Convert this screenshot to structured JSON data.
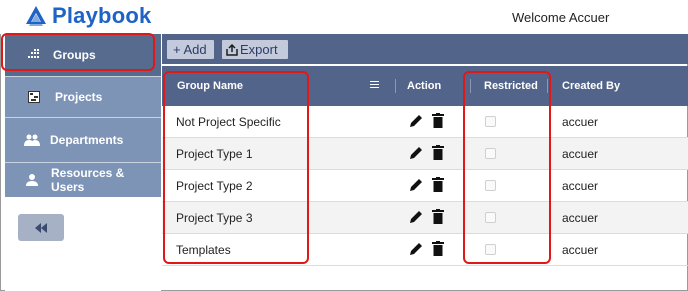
{
  "app": {
    "title": "Playbook",
    "welcome": "Welcome Accuer"
  },
  "sidebar": {
    "items": [
      {
        "label": "Groups",
        "icon": "groups-icon",
        "active": true
      },
      {
        "label": "Projects",
        "icon": "projects-icon",
        "active": false
      },
      {
        "label": "Departments",
        "icon": "departments-icon",
        "active": false
      },
      {
        "label": "Resources & Users",
        "icon": "user-icon",
        "active": false
      }
    ],
    "collapse_icon": "double-chevron-left-icon"
  },
  "toolbar": {
    "add_label": "+ Add",
    "export_label": "Export"
  },
  "table": {
    "columns": [
      "Group Name",
      "Action",
      "Restricted",
      "Created By"
    ],
    "rows": [
      {
        "name": "Not Project Specific",
        "restricted": false,
        "created_by": "accuer"
      },
      {
        "name": "Project Type 1",
        "restricted": false,
        "created_by": "accuer"
      },
      {
        "name": "Project Type 2",
        "restricted": false,
        "created_by": "accuer"
      },
      {
        "name": "Project Type 3",
        "restricted": false,
        "created_by": "accuer"
      },
      {
        "name": "Templates",
        "restricted": false,
        "created_by": "accuer"
      }
    ]
  },
  "colors": {
    "brand": "#1e63c5",
    "header_bar": "#52648a",
    "sidebar": "#7d94b7",
    "sidebar_active": "#566b8e",
    "highlight": "#e01818"
  }
}
